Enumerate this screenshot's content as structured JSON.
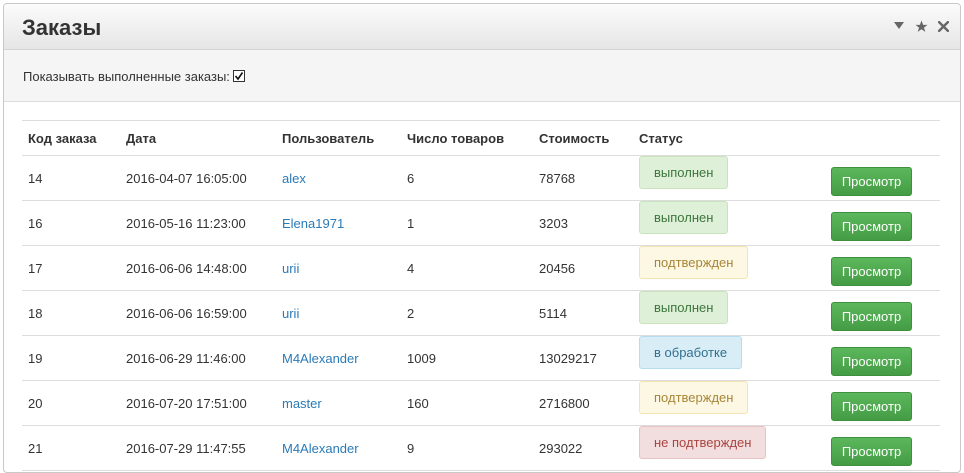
{
  "panel": {
    "title": "Заказы",
    "icons": [
      "caret-down-icon",
      "star-icon",
      "close-icon"
    ]
  },
  "filter": {
    "label": "Показывать выполненные заказы:",
    "checked": true
  },
  "table": {
    "headers": [
      "Код заказа",
      "Дата",
      "Пользователь",
      "Число товаров",
      "Стоимость",
      "Статус",
      ""
    ],
    "rows": [
      {
        "id": "14",
        "date": "2016-04-07 16:05:00",
        "user": "alex",
        "count": "6",
        "price": "78768",
        "status": "выполнен",
        "status_type": "done",
        "action": "Просмотр"
      },
      {
        "id": "16",
        "date": "2016-05-16 11:23:00",
        "user": "Elena1971",
        "count": "1",
        "price": "3203",
        "status": "выполнен",
        "status_type": "done",
        "action": "Просмотр"
      },
      {
        "id": "17",
        "date": "2016-06-06 14:48:00",
        "user": "urii",
        "count": "4",
        "price": "20456",
        "status": "подтвержден",
        "status_type": "confirm",
        "action": "Просмотр"
      },
      {
        "id": "18",
        "date": "2016-06-06 16:59:00",
        "user": "urii",
        "count": "2",
        "price": "5114",
        "status": "выполнен",
        "status_type": "done",
        "action": "Просмотр"
      },
      {
        "id": "19",
        "date": "2016-06-29 11:46:00",
        "user": "M4Alexander",
        "count": "1009",
        "price": "13029217",
        "status": "в обработке",
        "status_type": "process",
        "action": "Просмотр"
      },
      {
        "id": "20",
        "date": "2016-07-20 17:51:00",
        "user": "master",
        "count": "160",
        "price": "2716800",
        "status": "подтвержден",
        "status_type": "confirm",
        "action": "Просмотр"
      },
      {
        "id": "21",
        "date": "2016-07-29 11:47:55",
        "user": "M4Alexander",
        "count": "9",
        "price": "293022",
        "status": "не подтвержден",
        "status_type": "notconf",
        "action": "Просмотр"
      }
    ]
  },
  "colors": {
    "link": "#2a7ab8",
    "button_green": "#5cb85c",
    "status_done_bg": "#dff0d8",
    "status_confirm_bg": "#fcf8e3",
    "status_process_bg": "#d9edf7",
    "status_notconf_bg": "#f2dede"
  }
}
